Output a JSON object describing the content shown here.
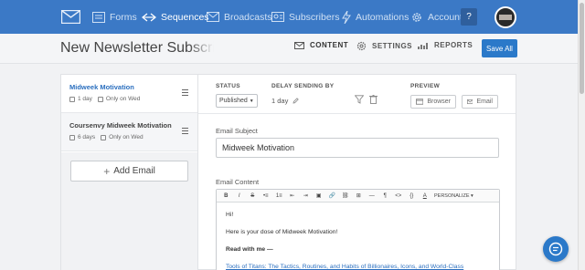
{
  "nav": {
    "items": [
      {
        "label": "Forms",
        "icon": "forms-icon",
        "active": false
      },
      {
        "label": "Sequences",
        "icon": "sequences-icon",
        "active": true
      },
      {
        "label": "Broadcasts",
        "icon": "broadcasts-icon",
        "active": false
      },
      {
        "label": "Subscribers",
        "icon": "subscribers-icon",
        "active": false
      },
      {
        "label": "Automations",
        "icon": "automations-icon",
        "active": false
      },
      {
        "label": "Account",
        "icon": "account-gear-icon",
        "active": false
      }
    ],
    "help_label": "?",
    "logo_icon": "envelope-logo-icon"
  },
  "subheader": {
    "title": "New Newsletter Subscriber S",
    "tabs": [
      {
        "label": "CONTENT",
        "icon": "envelope-icon",
        "active": true
      },
      {
        "label": "SETTINGS",
        "icon": "gear-icon",
        "active": false
      },
      {
        "label": "REPORTS",
        "icon": "bar-chart-icon",
        "active": false
      }
    ],
    "save_label": "Save All"
  },
  "emails": [
    {
      "name": "Midweek Motivation",
      "delay": "1 day",
      "schedule": "Only on Wed",
      "selected": true
    },
    {
      "name": "Coursenvy Midweek Motivation",
      "delay": "6 days",
      "schedule": "Only on Wed",
      "selected": false
    }
  ],
  "add_email_label": "Add Email",
  "settings": {
    "status_label": "STATUS",
    "status_value": "Published",
    "delay_label": "DELAY SENDING BY",
    "delay_value": "1 day",
    "preview_label": "PREVIEW",
    "browser_label": "Browser",
    "email_label": "Email"
  },
  "subject": {
    "label": "Email Subject",
    "value": "Midweek Motivation"
  },
  "content": {
    "label": "Email Content",
    "toolbar": [
      "B",
      "I",
      "S",
      "•≡",
      "1≡",
      "⇤",
      "⇥",
      "▣",
      "🔗",
      "⛓",
      "⊞",
      "—",
      "¶",
      "<>",
      "{}",
      "A"
    ],
    "personalize_label": "PERSONALIZE ▾",
    "lines": [
      "Hi!",
      "Here is your dose of Midweek Motivation!",
      "Read with me —",
      "Tools of Titans: The Tactics, Routines, and Habits of Billionaires, Icons, and World-Class"
    ]
  },
  "colors": {
    "nav_bg": "#3b79c6",
    "accent": "#2b79c9",
    "selected_text": "#2b6fbf"
  }
}
